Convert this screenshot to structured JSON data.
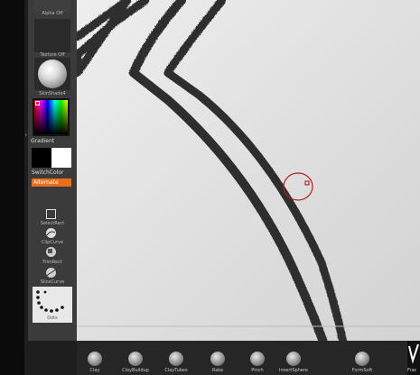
{
  "left_tray": {
    "top_label": "Alpha Off",
    "texture_label": "Texture Off",
    "material_label": "SkinShade4",
    "gradient_label": "Gradient",
    "switch_color_label": "SwitchColor",
    "alternate_label": "Alternate",
    "tools": [
      {
        "label": "SelectRect",
        "icon": "select-rect-icon"
      },
      {
        "label": "ClipCurve",
        "icon": "clip-curve-icon"
      },
      {
        "label": "TrimRect",
        "icon": "trim-rect-icon"
      },
      {
        "label": "SliceCurve",
        "icon": "slice-curve-icon"
      }
    ],
    "stroke_label": "Dots"
  },
  "brush_shelf": {
    "items": [
      "Clay",
      "ClayBuildup",
      "ClayTubes",
      "Rake",
      "Pinch",
      "InsertSphere",
      "FormSoft"
    ],
    "partial_label": "Frac"
  },
  "colors": {
    "accent_orange": "#e76f1c",
    "cursor_red": "#b02020",
    "ui_dark": "#3b3b3b",
    "canvas": "#e2e2e2"
  }
}
